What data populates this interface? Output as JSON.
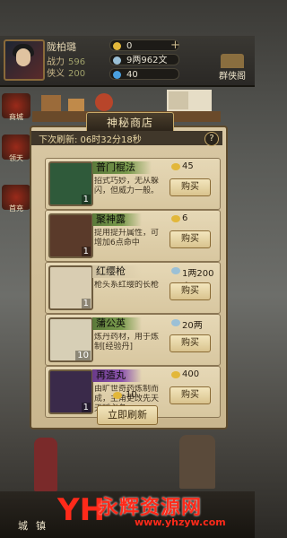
{
  "player": {
    "name": "陇柏璐",
    "power_label": "战力",
    "power": "596",
    "fame_label": "侠义",
    "fame": "200"
  },
  "resources": [
    {
      "value": "0",
      "color": "#e2b73a"
    },
    {
      "value": "9两962文",
      "color": "#9bc0d6"
    },
    {
      "value": "40",
      "color": "#4aa0e0"
    }
  ],
  "hall_label": "群侠阁",
  "side_labels": [
    "商城",
    "领天",
    "首充"
  ],
  "shop": {
    "title": "神秘商店",
    "refresh_text": "下次刷新: 06时32分18秒",
    "help_icon": "?",
    "items": [
      {
        "name": "普门棍法",
        "name_style": "g",
        "desc": "招式巧妙，无从躲闪，但威力一般。",
        "price": "45",
        "currency_color": "#e2b73a",
        "qty": "1",
        "icon_color": "#2f5a3a",
        "buy": "购买"
      },
      {
        "name": "聚神露",
        "name_style": "g",
        "desc": "提用提升属性，可增加6点命中",
        "price": "6",
        "currency_color": "#e2b73a",
        "qty": "1",
        "icon_color": "#5a3a2a",
        "buy": "购买"
      },
      {
        "name": "红缨枪",
        "name_style": "w",
        "desc": "枪头系红缨的长枪",
        "price": "1两200文",
        "currency_color": "#9bc0d6",
        "qty": "1",
        "icon_color": "#d9cdb2",
        "buy": "购买"
      },
      {
        "name": "蒲公英",
        "name_style": "g",
        "desc": "炼丹药材，用于炼制[经验丹]",
        "price": "20两",
        "currency_color": "#9bc0d6",
        "qty": "10",
        "icon_color": "#d7cfb6",
        "buy": "购买"
      },
      {
        "name": "再造丸",
        "name_style": "p",
        "desc": "由旷世奇药炼制而成，主角更改先天天赋必备",
        "price": "400",
        "currency_color": "#e2b73a",
        "qty": "1",
        "icon_color": "#3a2a4a",
        "buy": "购买"
      }
    ],
    "refresh_cost": "10",
    "refresh_button": "立即刷新"
  },
  "nav": [
    "城",
    "镇"
  ],
  "watermark": {
    "logo": "YH",
    "title": "永辉资源网",
    "url": "www.yhzyw.com"
  }
}
